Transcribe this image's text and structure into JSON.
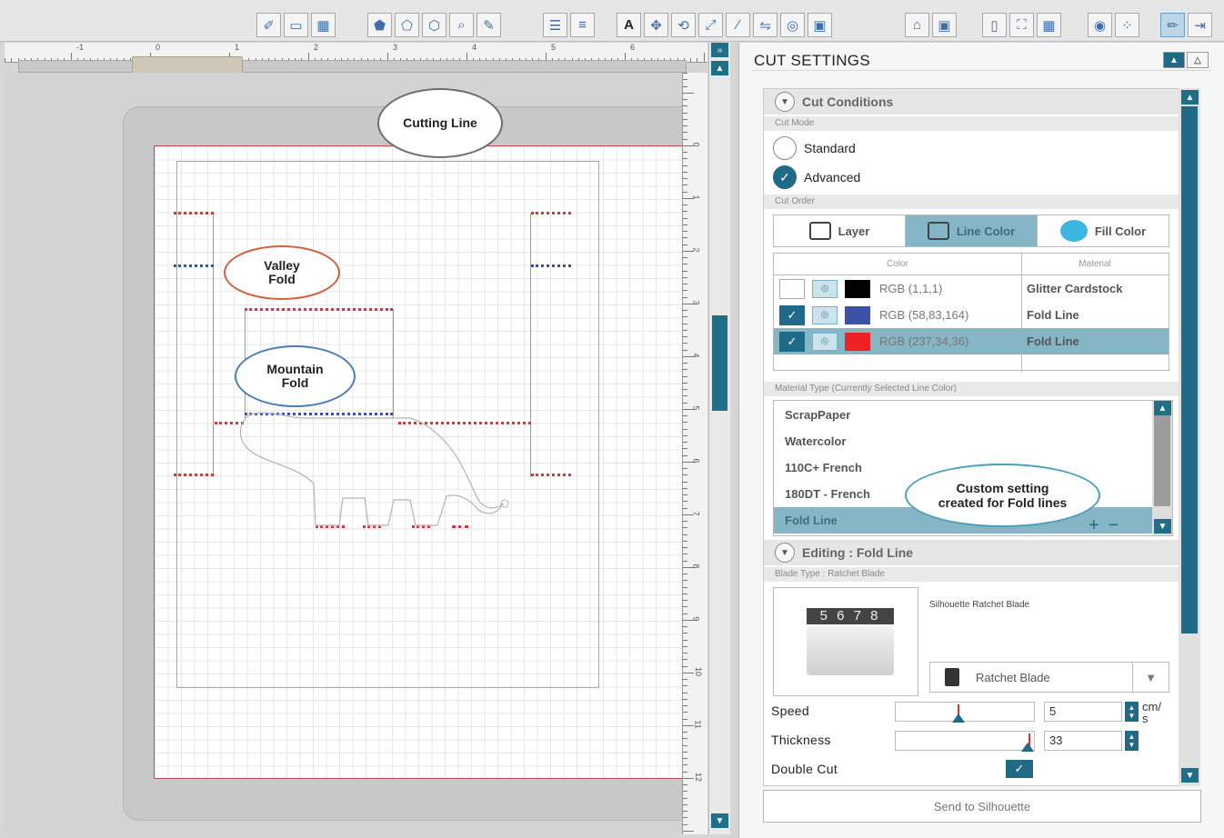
{
  "ruler": {
    "numbers": [
      "-1",
      "0",
      "1",
      "2",
      "3",
      "4",
      "5",
      "6"
    ]
  },
  "vruler": {
    "numbers": [
      "0",
      "1",
      "2",
      "3",
      "4",
      "5",
      "6",
      "7",
      "8",
      "9",
      "10",
      "11",
      "12"
    ]
  },
  "callouts": {
    "cutting_line": "Cutting Line",
    "valley_fold": "Valley Fold",
    "mountain_fold": "Mountain Fold",
    "custom_setting": "Custom setting created for Fold lines"
  },
  "panel": {
    "title": "CUT SETTINGS",
    "cut_conditions_header": "Cut Conditions",
    "cut_mode_label": "Cut Mode",
    "mode_standard": "Standard",
    "mode_advanced": "Advanced",
    "cut_order_label": "Cut Order",
    "tabs": [
      {
        "label": "Layer"
      },
      {
        "label": "Line Color"
      },
      {
        "label": "Fill Color"
      }
    ],
    "table": {
      "col_color": "Color",
      "col_material": "Material",
      "rows": [
        {
          "checked": false,
          "swatch": "#010101",
          "rgb": "RGB (1,1,1)",
          "material": "Glitter Cardstock",
          "selected": false
        },
        {
          "checked": true,
          "swatch": "#3a53a4",
          "rgb": "RGB (58,83,164)",
          "material": "Fold Line",
          "selected": false
        },
        {
          "checked": true,
          "swatch": "#ed2224",
          "rgb": "RGB (237,34,36)",
          "material": "Fold Line",
          "selected": true
        }
      ]
    },
    "material_type_label": "Material Type (Currently Selected Line Color)",
    "materials": [
      "ScrapPaper",
      "Watercolor",
      "110C+ French",
      "180DT - French",
      "Fold Line"
    ],
    "selected_material": "Fold Line",
    "editing_header": "Editing : Fold Line",
    "blade_type_label": "Blade Type : Ratchet Blade",
    "blade_readout": "5 6 7 8",
    "blade_name": "Silhouette Ratchet Blade",
    "blade_select": "Ratchet Blade",
    "speed_label": "Speed",
    "speed_value": "5",
    "speed_unit": "cm/ s",
    "thickness_label": "Thickness",
    "thickness_value": "33",
    "double_cut_label": "Double Cut",
    "send_button": "Send to Silhouette"
  },
  "colors": {
    "accent": "#1e6a87",
    "selection": "#86b5c6",
    "cut_red": "#d8373a",
    "fold_blue": "#3b53a4"
  }
}
